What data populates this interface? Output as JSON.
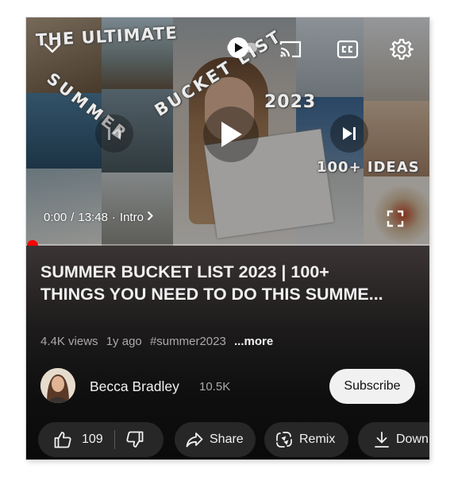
{
  "player": {
    "thumbnail_overlay_text": [
      "THE ULTIMATE",
      "BUCKET LIST",
      "2023",
      "100+ IDEAS",
      "SUMMER"
    ],
    "current_time": "0:00",
    "duration": "13:48",
    "chapter": "Intro",
    "progress": 0.0,
    "icons": [
      "chevron-down-icon",
      "autoplay-toggle-icon",
      "cast-icon",
      "closed-captions-icon",
      "settings-gear-icon",
      "previous-icon",
      "play-icon",
      "next-icon",
      "fullscreen-icon"
    ]
  },
  "video": {
    "title_line1": "SUMMER BUCKET LIST 2023 | 100+",
    "title_line2": "THINGS YOU NEED TO DO THIS SUMME...",
    "views": "4.4K views",
    "age": "1y ago",
    "hashtag": "#summer2023",
    "more": "...more"
  },
  "channel": {
    "name": "Becca Bradley",
    "subscribers": "10.5K",
    "subscribe_label": "Subscribe"
  },
  "actions": {
    "like_count": "109",
    "share_label": "Share",
    "remix_label": "Remix",
    "download_label": "Down"
  },
  "colors": {
    "background": "#0f0f0f",
    "progress": "#ff0000",
    "pill": "#272727",
    "subscribe_bg": "#f1f1f1"
  }
}
